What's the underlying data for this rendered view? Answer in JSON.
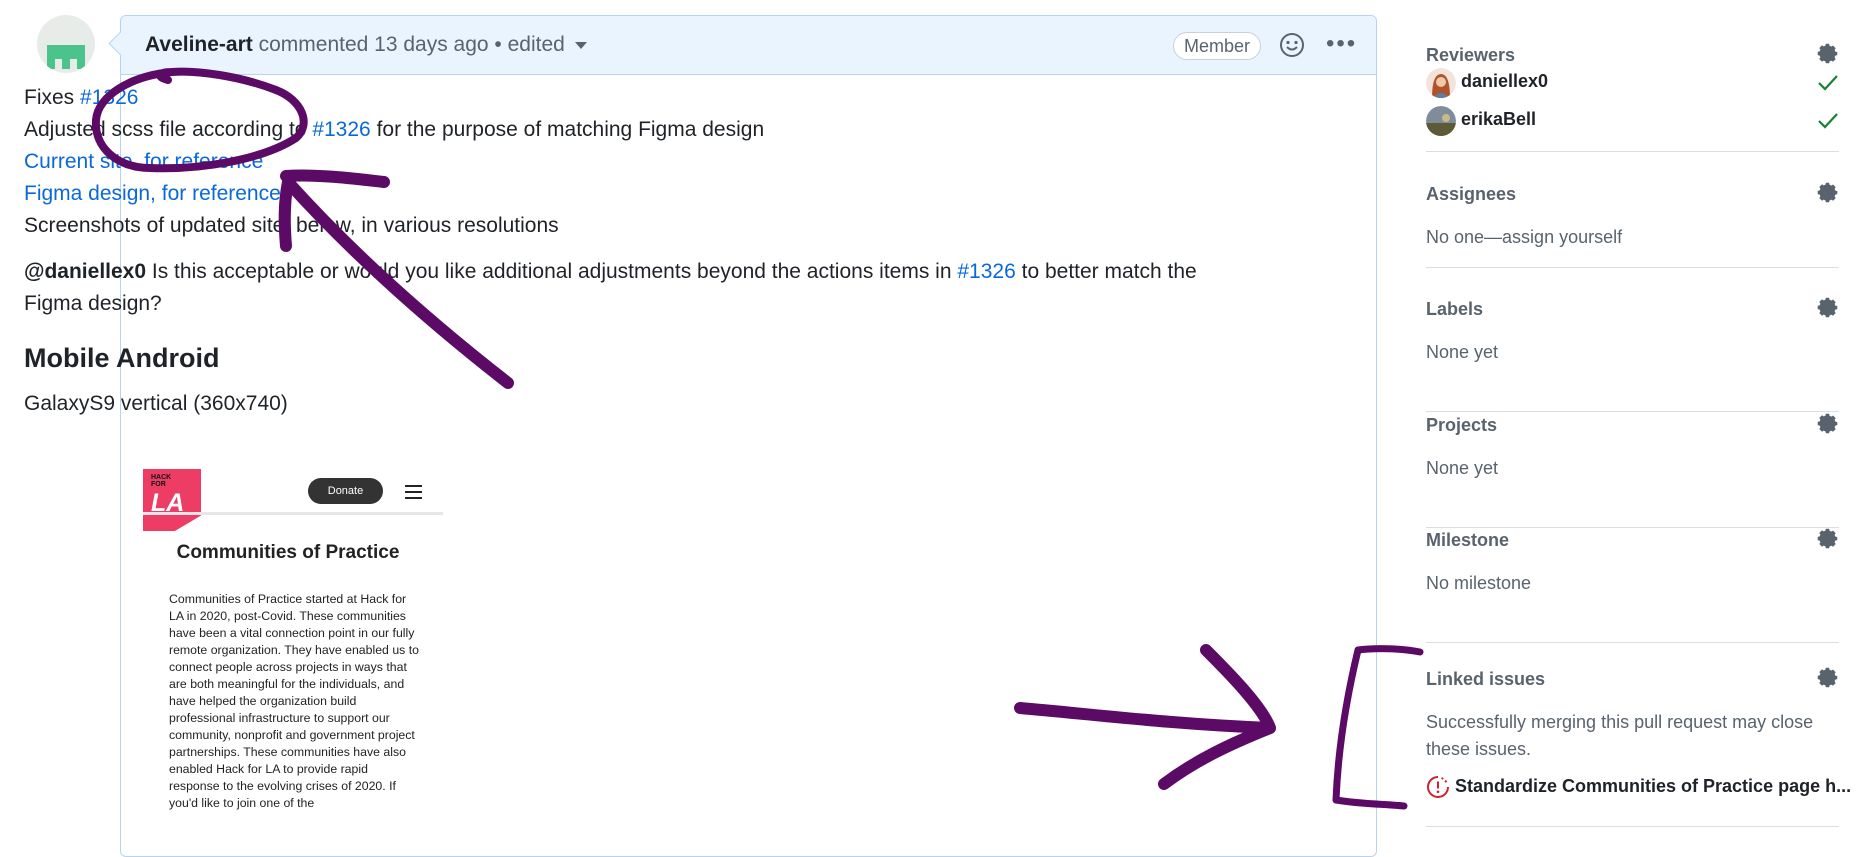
{
  "comment": {
    "author": "Aveline-art",
    "action": "commented 13 days ago • edited",
    "role_badge": "Member",
    "body": {
      "fixes_label": "Fixes",
      "fixes_link": "#1326",
      "line1_pre": "Adjusted scss file according to",
      "line1_link": "#1326",
      "line1_post": "for the purpose of matching Figma design",
      "link_current": "Current site, for reference",
      "link_figma": "Figma design, for reference",
      "screenshots_line": "Screenshots of updated site, below, in various resolutions",
      "mention": "@daniellex0",
      "question_pre": "Is this acceptable or would you like additional adjustments beyond the actions items in",
      "question_link": "#1326",
      "question_post": "to better match the Figma design?",
      "heading": "Mobile Android",
      "device": "GalaxyS9 vertical (360x740)"
    },
    "embedded_screenshot": {
      "logo_small": "HACK FOR",
      "logo_big": "LA",
      "donate": "Donate",
      "title": "Communities of Practice",
      "text": "Communities of Practice started at Hack for LA in 2020, post-Covid. These communities have been a vital connection point in our fully remote organization. They have enabled us to connect people across projects in ways that are both meaningful for the individuals, and have helped the organization build professional infrastructure to support our community, nonprofit and government project partnerships. These communities have also enabled Hack for LA to provide rapid response to the evolving crises of 2020. If you'd like to join one of the"
    }
  },
  "sidebar": {
    "reviewers": {
      "title": "Reviewers",
      "items": [
        {
          "name": "daniellex0",
          "status": "approved"
        },
        {
          "name": "erikaBell",
          "status": "approved"
        }
      ]
    },
    "assignees": {
      "title": "Assignees",
      "value": "No one—assign yourself"
    },
    "labels": {
      "title": "Labels",
      "value": "None yet"
    },
    "projects": {
      "title": "Projects",
      "value": "None yet"
    },
    "milestone": {
      "title": "Milestone",
      "value": "No milestone"
    },
    "linked_issues": {
      "title": "Linked issues",
      "description": "Successfully merging this pull request may close these issues.",
      "issue": "Standardize Communities of Practice page h..."
    }
  },
  "colors": {
    "link": "#0969da",
    "annotation_ink": "#5b0a66",
    "check": "#1a7f37",
    "issue_icon": "#cf222e"
  }
}
